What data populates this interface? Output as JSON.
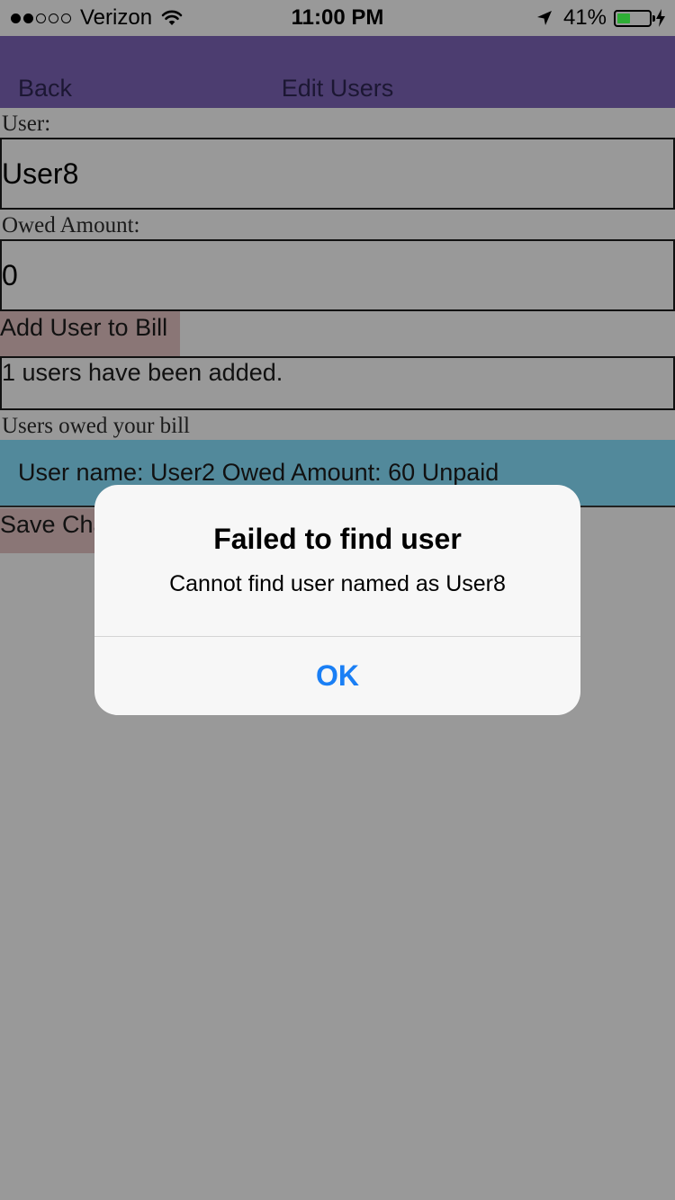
{
  "status_bar": {
    "carrier": "Verizon",
    "time": "11:00 PM",
    "battery_percent": "41%",
    "battery_level": 0.41,
    "signal_bars_filled": 2,
    "signal_bars_total": 5,
    "battery_color": "#2eae35"
  },
  "nav": {
    "back_label": "Back",
    "title": "Edit Users",
    "background_color": "#4c3d70"
  },
  "form": {
    "user_label": "User:",
    "user_value": "User8",
    "amount_label": "Owed Amount:",
    "amount_value": "0",
    "add_button_label": "Add User to Bill",
    "status_message": "1 users have been added.",
    "list_heading": "Users owed your bill",
    "users": [
      "User name: User2 Owed Amount: 60 Unpaid"
    ],
    "save_button_label": "Save Changes"
  },
  "alert": {
    "title": "Failed to find user",
    "message": "Cannot find user named as User8",
    "ok_label": "OK",
    "ok_color": "#1a7ff5"
  }
}
